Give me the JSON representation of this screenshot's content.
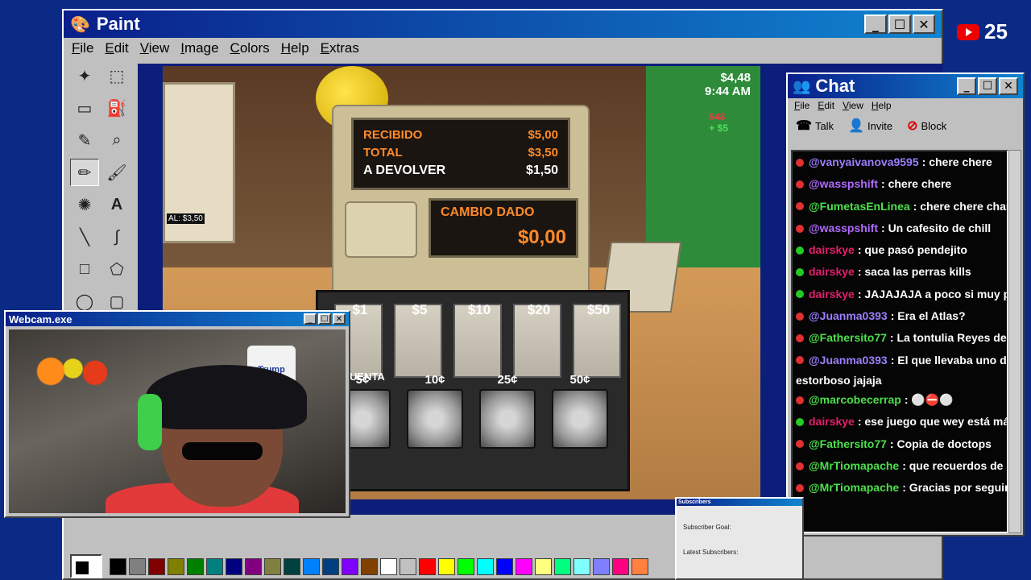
{
  "overlay": {
    "yt_count": "25"
  },
  "paint": {
    "title": "Paint",
    "menu": [
      "File",
      "Edit",
      "View",
      "Image",
      "Colors",
      "Help",
      "Extras"
    ],
    "tools": [
      "free-select-icon",
      "rect-select-icon",
      "eraser-icon",
      "fill-icon",
      "color-picker-icon",
      "magnifier-icon",
      "pencil-icon",
      "brush-icon",
      "airbrush-icon",
      "text-icon",
      "line-icon",
      "curve-icon",
      "rectangle-icon",
      "polygon-icon",
      "ellipse-icon",
      "rounded-rect-icon"
    ],
    "palette": [
      "#000000",
      "#808080",
      "#800000",
      "#808000",
      "#008000",
      "#008080",
      "#000080",
      "#800080",
      "#808040",
      "#004040",
      "#0080ff",
      "#004080",
      "#8000ff",
      "#804000",
      "#ffffff",
      "#c0c0c0",
      "#ff0000",
      "#ffff00",
      "#00ff00",
      "#00ffff",
      "#0000ff",
      "#ff00ff",
      "#ffff80",
      "#00ff80",
      "#80ffff",
      "#8080ff",
      "#ff0080",
      "#ff8040"
    ]
  },
  "game": {
    "money": "$4,48",
    "time": "9:44 AM",
    "delta_old": "$43",
    "delta_new": "+ $5",
    "monitor_text": "AL: $3,50",
    "register": {
      "recibido_label": "RECIBIDO",
      "recibido_val": "$5,00",
      "total_label": "TOTAL",
      "total_val": "$3,50",
      "devolver_label": "A DEVOLVER",
      "devolver_val": "$1,50",
      "cambio_label": "CAMBIO DADO",
      "cambio_val": "$0,00"
    },
    "bills": [
      "$1",
      "$5",
      "$10",
      "$20",
      "$50"
    ],
    "coins": [
      "5¢",
      "10¢",
      "25¢",
      "50¢"
    ],
    "side_text": "UENTA"
  },
  "webcam": {
    "title": "Webcam.exe",
    "mug_text": "Trump"
  },
  "chat": {
    "title": "Chat",
    "menu": [
      "File",
      "Edit",
      "View",
      "Help"
    ],
    "tools": {
      "talk": "Talk",
      "invite": "Invite",
      "block": "Block"
    },
    "messages": [
      {
        "user": "@vanyaivanova9595",
        "text": ": chere chere",
        "color": "#9b7fff",
        "badge": "#e03030"
      },
      {
        "user": "@wasspshift",
        "text": ": chere chere",
        "color": "#b06aff",
        "badge": "#e03030"
      },
      {
        "user": "@FumetasEnLinea",
        "text": ": chere chere chamo werever",
        "color": "#4be04b",
        "badge": "#e03030"
      },
      {
        "user": "@wasspshift",
        "text": ": Un cafesito de chill",
        "color": "#b06aff",
        "badge": "#e03030"
      },
      {
        "user": "dairskye",
        "text": ": que pasó pendejito",
        "color": "#e0206a",
        "badge": "#22cc22"
      },
      {
        "user": "dairskye",
        "text": ": saca las perras kills",
        "color": "#e0206a",
        "badge": "#22cc22"
      },
      {
        "user": "dairskye",
        "text": ": JAJAJAJA a poco si muy perro al",
        "color": "#e0206a",
        "badge": "#22cc22"
      },
      {
        "user": "@Juanma0393",
        "text": ": Era el Atlas?",
        "color": "#9b7fff",
        "badge": "#e03030"
      },
      {
        "user": "@Fathersito77",
        "text": ": La tontulia Reyes de la irrele",
        "color": "#4be04b",
        "badge": "#e03030"
      },
      {
        "user": "@Juanma0393",
        "text": ": El que llevaba uno de mo",
        "color": "#9b7fff",
        "badge": "#e03030"
      },
      {
        "user": "",
        "text": "estorboso jajaja",
        "color": "#ffffff",
        "badge": ""
      },
      {
        "user": "@marcobecerrap",
        "text": ": ⚪⛔⚪",
        "color": "#4be04b",
        "badge": "#e03030"
      },
      {
        "user": "dairskye",
        "text": ": ese juego que wey está más muer",
        "color": "#e0206a",
        "badge": "#22cc22"
      },
      {
        "user": "@Fathersito77",
        "text": ": Copia de doctops",
        "color": "#4be04b",
        "badge": "#e03030"
      },
      {
        "user": "@MrTiomapache",
        "text": ": que recuerdos de ese roa",
        "color": "#4be04b",
        "badge": "#e03030"
      },
      {
        "user": "@MrTiomapache",
        "text": ": Gracias por seguir ahí Mo",
        "color": "#4be04b",
        "badge": "#e03030"
      }
    ]
  },
  "subs": {
    "title": "Subscribers",
    "goal": "Subscriber Goal:",
    "latest": "Latest Subscribers:"
  }
}
